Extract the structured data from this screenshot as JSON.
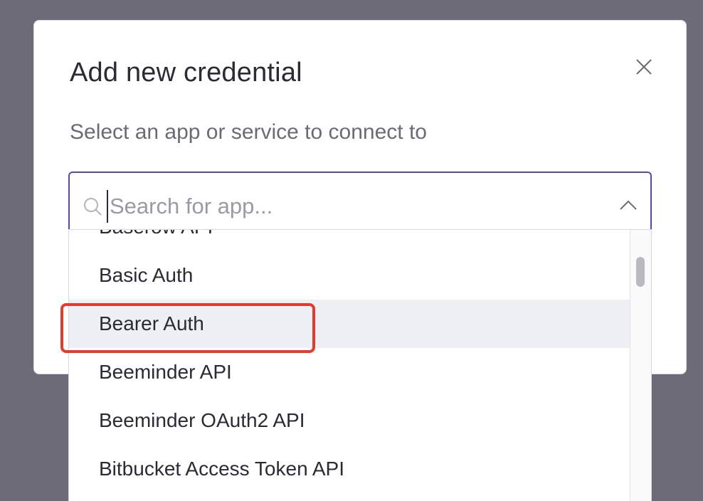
{
  "modal": {
    "title": "Add new credential",
    "subtitle": "Select an app or service to connect to"
  },
  "search": {
    "placeholder": "Search for app...",
    "value": ""
  },
  "dropdown": {
    "items": [
      {
        "label": "Baserow API"
      },
      {
        "label": "Basic Auth"
      },
      {
        "label": "Bearer Auth"
      },
      {
        "label": "Beeminder API"
      },
      {
        "label": "Beeminder OAuth2 API"
      },
      {
        "label": "Bitbucket Access Token API"
      }
    ],
    "hovered_index": 2
  },
  "colors": {
    "accent": "#5b4aa3",
    "highlight": "#e63a2c",
    "hover_bg": "#eef0f5",
    "overlay": "#6e6b78"
  },
  "icons": {
    "close": "close-icon",
    "search": "search-icon",
    "collapse": "chevron-up-icon"
  }
}
